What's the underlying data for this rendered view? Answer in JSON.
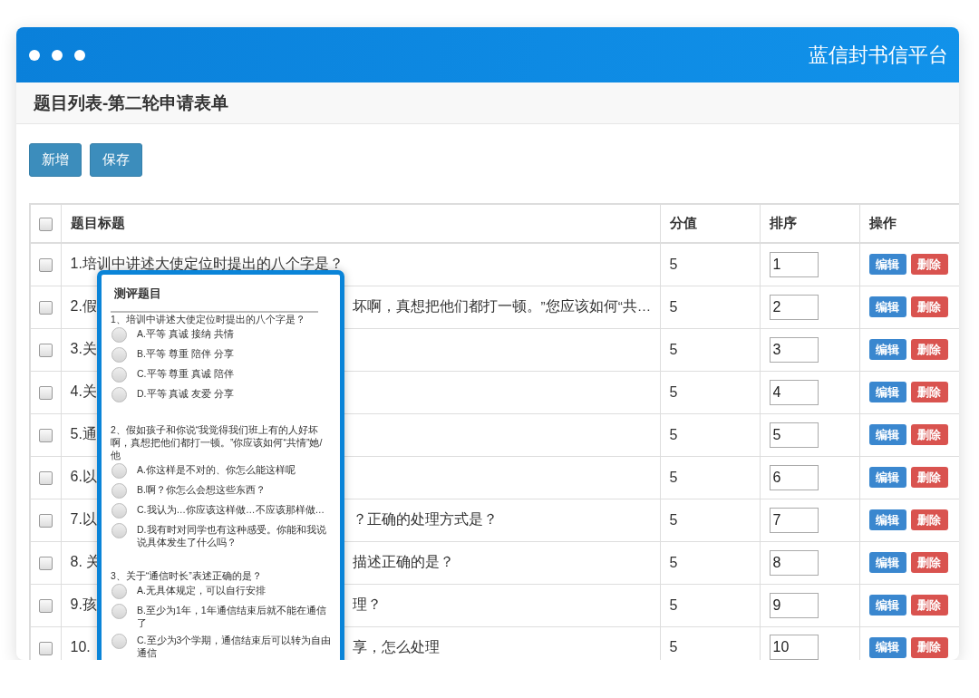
{
  "window": {
    "title": "蓝信封书信平台"
  },
  "page_title": "题目列表-第二轮申请表单",
  "toolbar": [
    {
      "label": "新增"
    },
    {
      "label": "保存"
    }
  ],
  "table": {
    "header_checked": false,
    "columns": [
      "题目标题",
      "分值",
      "排序",
      "操作"
    ],
    "rows": [
      {
        "checked": false,
        "title_start": "1.培训中讲述大使定位时提出的八个字是？",
        "score": "5",
        "order": "1",
        "actions": [
          {
            "label": "编辑",
            "kind": "edit"
          },
          {
            "label": "删除",
            "kind": "delete"
          }
        ]
      },
      {
        "checked": false,
        "title_start": "2.假",
        "title_end": "坏啊，真想把他们都打一顿。”您应该如何“共…",
        "score": "5",
        "order": "2",
        "actions": [
          {
            "label": "编辑",
            "kind": "edit"
          },
          {
            "label": "删除",
            "kind": "delete"
          }
        ]
      },
      {
        "checked": false,
        "title_start": "3.关",
        "score": "5",
        "order": "3",
        "actions": [
          {
            "label": "编辑",
            "kind": "edit"
          },
          {
            "label": "删除",
            "kind": "delete"
          }
        ]
      },
      {
        "checked": false,
        "title_start": "4.关",
        "score": "5",
        "order": "4",
        "actions": [
          {
            "label": "编辑",
            "kind": "edit"
          },
          {
            "label": "删除",
            "kind": "delete"
          }
        ]
      },
      {
        "checked": false,
        "title_start": "5.通",
        "score": "5",
        "order": "5",
        "actions": [
          {
            "label": "编辑",
            "kind": "edit"
          },
          {
            "label": "删除",
            "kind": "delete"
          }
        ]
      },
      {
        "checked": false,
        "title_start": "6.以",
        "score": "5",
        "order": "6",
        "actions": [
          {
            "label": "编辑",
            "kind": "edit"
          },
          {
            "label": "删除",
            "kind": "delete"
          }
        ]
      },
      {
        "checked": false,
        "title_start": "7.以",
        "title_end": "？正确的处理方式是？",
        "score": "5",
        "order": "7",
        "actions": [
          {
            "label": "编辑",
            "kind": "edit"
          },
          {
            "label": "删除",
            "kind": "delete"
          }
        ]
      },
      {
        "checked": false,
        "title_start": "8. 关",
        "title_end": "描述正确的是？",
        "score": "5",
        "order": "8",
        "actions": [
          {
            "label": "编辑",
            "kind": "edit"
          },
          {
            "label": "删除",
            "kind": "delete"
          }
        ]
      },
      {
        "checked": false,
        "title_start": "9.孩",
        "title_end": "理？",
        "score": "5",
        "order": "9",
        "actions": [
          {
            "label": "编辑",
            "kind": "edit"
          },
          {
            "label": "删除",
            "kind": "delete"
          }
        ]
      },
      {
        "checked": false,
        "title_start": "10.",
        "title_end": "享，怎么处理",
        "score": "5",
        "order": "10",
        "actions": [
          {
            "label": "编辑",
            "kind": "edit"
          },
          {
            "label": "删除",
            "kind": "delete"
          }
        ]
      }
    ]
  },
  "popup": {
    "title": "测评题目",
    "questions": [
      {
        "text": "1、培训中讲述大使定位时提出的八个字是？",
        "options": [
          {
            "label": "A.平等 真诚 接纳 共情",
            "selected": false
          },
          {
            "label": "B.平等 尊重 陪伴 分享",
            "selected": false
          },
          {
            "label": "C.平等 尊重 真诚 陪伴",
            "selected": false
          },
          {
            "label": "D.平等 真诚 友爱 分享",
            "selected": false
          }
        ]
      },
      {
        "text": "2、假如孩子和你说“我觉得我们班上有的人好坏啊，真想把他们都打一顿。”你应该如何“共情”她/他",
        "options": [
          {
            "label": "A.你这样是不对的、你怎么能这样呢",
            "selected": false
          },
          {
            "label": "B.啊？你怎么会想这些东西？",
            "selected": false
          },
          {
            "label": "C.我认为…你应该这样做…不应该那样做…",
            "selected": false
          },
          {
            "label": "D.我有时对同学也有这种感受。你能和我说说具体发生了什么吗？",
            "selected": false
          }
        ]
      },
      {
        "text": "3、关于“通信时长”表述正确的是？",
        "options": [
          {
            "label": "A.无具体规定，可以自行安排",
            "selected": false
          },
          {
            "label": "B.至少为1年，1年通信结束后就不能在通信了",
            "selected": false
          },
          {
            "label": "C.至少为3个学期，通信结束后可以转为自由通信",
            "selected": false
          }
        ]
      }
    ]
  }
}
